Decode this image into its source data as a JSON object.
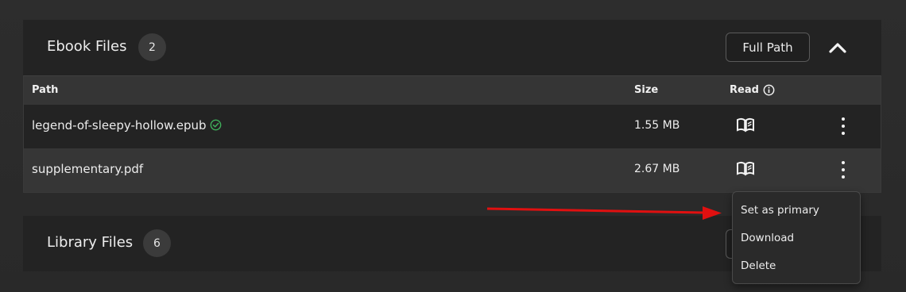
{
  "ebook_files": {
    "title": "Ebook Files",
    "count": "2",
    "full_path_label": "Full Path",
    "table": {
      "headers": {
        "path": "Path",
        "size": "Size",
        "read": "Read"
      },
      "rows": [
        {
          "path": "legend-of-sleepy-hollow.epub",
          "size": "1.55 MB",
          "primary": true
        },
        {
          "path": "supplementary.pdf",
          "size": "2.67 MB",
          "primary": false
        }
      ]
    }
  },
  "library_files": {
    "title": "Library Files",
    "count": "6"
  },
  "context_menu": {
    "items": [
      "Set as primary",
      "Download",
      "Delete"
    ]
  },
  "colors": {
    "annotation_arrow": "#e01010",
    "primary_check": "#3fae5a"
  },
  "icons": [
    "chevron-up-icon",
    "info-icon",
    "check-circle-icon",
    "book-read-icon",
    "more-vertical-icon"
  ]
}
